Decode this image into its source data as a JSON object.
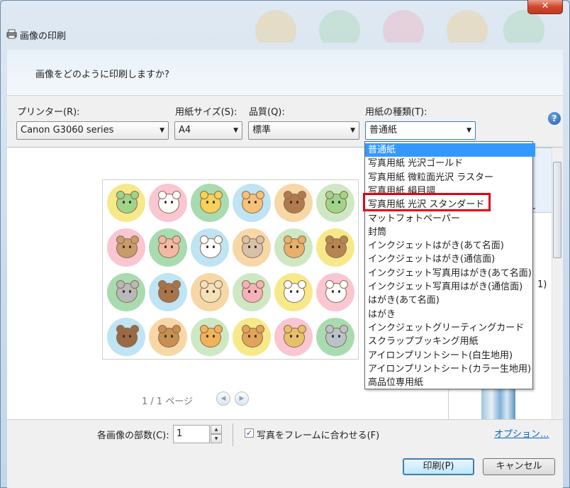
{
  "window": {
    "title": "画像の印刷",
    "close_symbol": "✕"
  },
  "header": {
    "question": "画像をどのように印刷しますか?"
  },
  "options": {
    "printer_label": "プリンター(R):",
    "printer_value": "Canon G3060 series",
    "paper_size_label": "用紙サイズ(S):",
    "paper_size_value": "A4",
    "quality_label": "品質(Q):",
    "quality_value": "標準",
    "paper_type_label": "用紙の種類(T):",
    "paper_type_value": "普通紙",
    "help_symbol": "?"
  },
  "paper_type_options": [
    "普通紙",
    "写真用紙 光沢ゴールド",
    "写真用紙 微粒面光沢 ラスター",
    "写真用紙 絹目調",
    "写真用紙 光沢 スタンダード",
    "マットフォトペーパー",
    "封筒",
    "インクジェットはがき(あて名面)",
    "インクジェットはがき(通信面)",
    "インクジェット写真用はがき(あて名面)",
    "インクジェット写真用はがき(通信面)",
    "はがき(あて名面)",
    "はがき",
    "インクジェットグリーティングカード",
    "スクラップブッキング用紙",
    "アイロンプリントシート(白生地用)",
    "アイロンプリントシート(カラー生地用)",
    "高品位専用紙"
  ],
  "selected_option": "普通紙",
  "highlighted_option": "写真用紙 光沢 スタンダード",
  "preview": {
    "page_indicator": "1 / 1 ページ",
    "prev_symbol": "◀",
    "next_symbol": "▶"
  },
  "thumb_panel": {
    "partial_text_1": "ー",
    "partial_text_2": "1)"
  },
  "bottom": {
    "copies_label": "各画像の部数(C):",
    "copies_value": "1",
    "spin_up": "▲",
    "spin_down": "▼",
    "fit_checked": true,
    "fit_mark": "✓",
    "fit_label": "写真をフレームに合わせる(F)",
    "options_link": "オプション..."
  },
  "buttons": {
    "print": "印刷(P)",
    "cancel": "キャンセル"
  },
  "colors": {
    "selection": "#3399ff",
    "highlight_box": "#e60012",
    "link": "#0066cc"
  }
}
